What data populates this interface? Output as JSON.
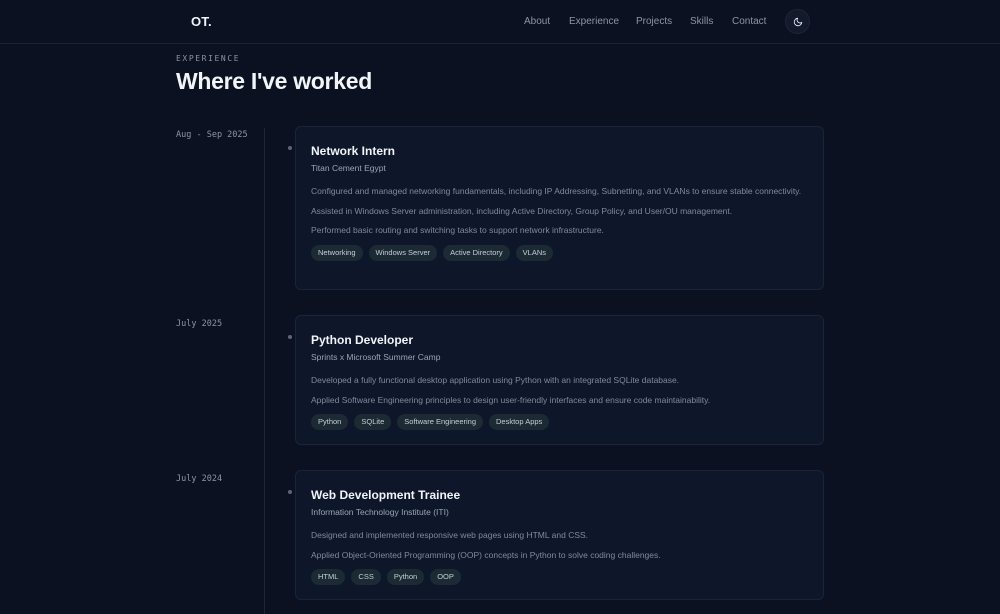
{
  "nav": {
    "logo": "OT.",
    "links": [
      "About",
      "Experience",
      "Projects",
      "Skills",
      "Contact"
    ],
    "theme_toggle_icon": "moon-icon"
  },
  "section": {
    "eyebrow": "EXPERIENCE",
    "title": "Where I've worked"
  },
  "experience": [
    {
      "date": "Aug - Sep 2025",
      "role": "Network Intern",
      "company": "Titan Cement Egypt",
      "points": [
        "Configured and managed networking fundamentals, including IP Addressing, Subnetting, and VLANs to ensure stable connectivity.",
        "Assisted in Windows Server administration, including Active Directory, Group Policy, and User/OU management.",
        "Performed basic routing and switching tasks to support network infrastructure."
      ],
      "tags": [
        "Networking",
        "Windows Server",
        "Active Directory",
        "VLANs"
      ]
    },
    {
      "date": "July 2025",
      "role": "Python Developer",
      "company": "Sprints x Microsoft Summer Camp",
      "points": [
        "Developed a fully functional desktop application using Python with an integrated SQLite database.",
        "Applied Software Engineering principles to design user-friendly interfaces and ensure code maintainability."
      ],
      "tags": [
        "Python",
        "SQLite",
        "Software Engineering",
        "Desktop Apps"
      ]
    },
    {
      "date": "July 2024",
      "role": "Web Development Trainee",
      "company": "Information Technology Institute (ITI)",
      "points": [
        "Designed and implemented responsive web pages using HTML and CSS.",
        "Applied Object-Oriented Programming (OOP) concepts in Python to solve coding challenges."
      ],
      "tags": [
        "HTML",
        "CSS",
        "Python",
        "OOP"
      ]
    }
  ]
}
